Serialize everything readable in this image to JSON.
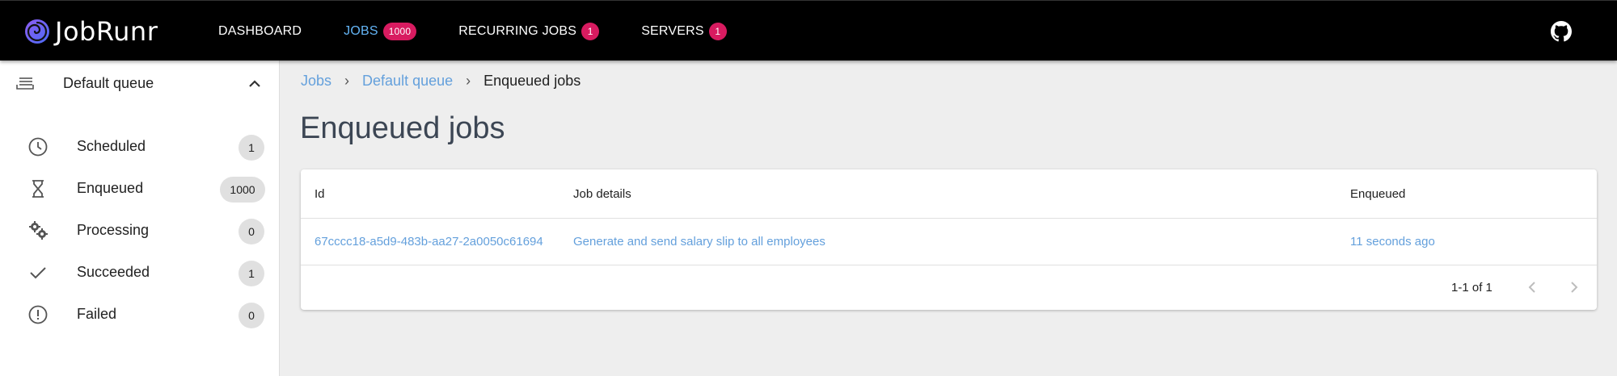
{
  "app": {
    "name": "JobRunr"
  },
  "nav": {
    "dashboard": "DASHBOARD",
    "jobs": "JOBS",
    "jobs_count": "1000",
    "recurring": "RECURRING JOBS",
    "recurring_count": "1",
    "servers": "SERVERS",
    "servers_count": "1"
  },
  "sidebar": {
    "queue": "Default queue",
    "items": [
      {
        "label": "Scheduled",
        "count": "1",
        "icon": "clock-icon"
      },
      {
        "label": "Enqueued",
        "count": "1000",
        "icon": "hourglass-icon"
      },
      {
        "label": "Processing",
        "count": "0",
        "icon": "gears-icon"
      },
      {
        "label": "Succeeded",
        "count": "1",
        "icon": "check-icon"
      },
      {
        "label": "Failed",
        "count": "0",
        "icon": "alert-circle-icon"
      }
    ]
  },
  "breadcrumb": {
    "jobs": "Jobs",
    "queue": "Default queue",
    "current": "Enqueued jobs"
  },
  "page": {
    "title": "Enqueued jobs"
  },
  "table": {
    "headers": {
      "id": "Id",
      "details": "Job details",
      "enqueued": "Enqueued"
    },
    "rows": [
      {
        "id": "67cccc18-a5d9-483b-aa27-2a0050c61694",
        "details": "Generate and send salary slip to all employees",
        "enqueued": "11 seconds ago"
      }
    ],
    "pagination": "1-1 of 1"
  },
  "colors": {
    "accent": "#64b5f6",
    "badge": "#d81b60",
    "link": "#64a0dc"
  }
}
